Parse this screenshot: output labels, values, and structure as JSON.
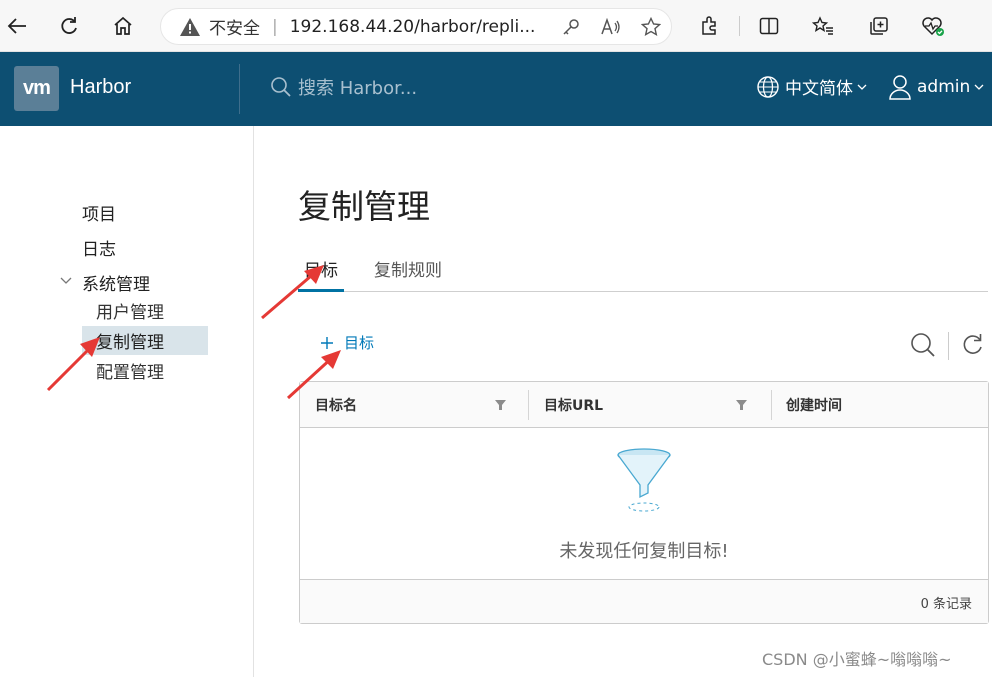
{
  "browser": {
    "insecure_label": "不安全",
    "separator": "|",
    "url": "192.168.44.20/harbor/repli..."
  },
  "header": {
    "logo_text": "vm",
    "app_name": "Harbor",
    "search_placeholder": "搜索 Harbor...",
    "language": "中文简体",
    "user": "admin"
  },
  "sidebar": {
    "items": [
      {
        "label": "项目"
      },
      {
        "label": "日志"
      },
      {
        "label": "系统管理"
      }
    ],
    "sub_items": [
      {
        "label": "用户管理"
      },
      {
        "label": "复制管理"
      },
      {
        "label": "配置管理"
      }
    ],
    "active_sub": "复制管理"
  },
  "main": {
    "title": "复制管理",
    "tabs": [
      {
        "label": "目标"
      },
      {
        "label": "复制规则"
      }
    ],
    "add_button": "目标",
    "grid": {
      "columns": [
        "目标名",
        "目标URL",
        "创建时间"
      ],
      "empty_message": "未发现任何复制目标!",
      "record_count": "0 条记录"
    }
  },
  "watermark": "CSDN @小蜜蜂~嗡嗡嗡~",
  "colors": {
    "header_bg": "#0d4f72",
    "accent": "#0079b8",
    "annotation_arrow": "#e53935"
  }
}
